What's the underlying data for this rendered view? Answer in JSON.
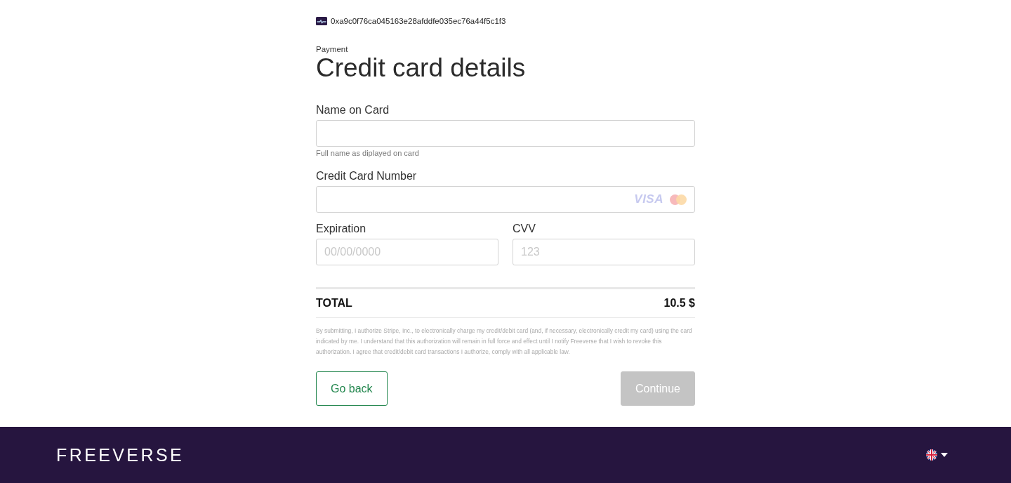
{
  "wallet": {
    "address": "0xa9c0f76ca045163e28afddfe035ec76a44f5c1f3"
  },
  "header": {
    "eyebrow": "Payment",
    "title": "Credit card details"
  },
  "rows": [
    [
      {
        "kind": "text",
        "label": "Name on Card",
        "hint": "Full name as diplayed on card"
      }
    ],
    [
      {
        "kind": "card",
        "label": "Credit Card Number",
        "brand": "VISA"
      }
    ],
    [
      {
        "kind": "text",
        "label": "Expiration",
        "placeholder": "00/00/0000"
      },
      {
        "kind": "text",
        "label": "CVV",
        "placeholder": "123"
      }
    ]
  ],
  "total": {
    "label": "TOTAL",
    "amount": "10.5 $"
  },
  "legal": "By submitting, I authorize Stripe, Inc., to electronically charge my credit/debit card (and, if necessary, electronically credit my card) using the card indicated by me. I understand that this authorization will remain in full force and effect until I notify Freeverse that I wish to revoke this authorization. I agree that credit/debit card transactions I authorize, comply with all applicable law.",
  "buttons": [
    {
      "label": "Go back",
      "kind": "outline",
      "disabled": false
    },
    {
      "label": "Continue",
      "kind": "primary",
      "disabled": true
    }
  ],
  "footer": {
    "logo": "FREEVERSE"
  }
}
